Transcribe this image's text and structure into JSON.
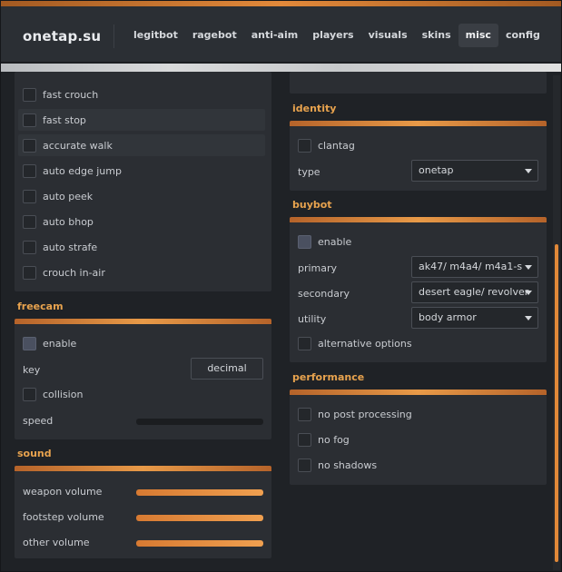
{
  "header": {
    "logo": "onetap.su",
    "tabs": [
      {
        "label": "legitbot"
      },
      {
        "label": "ragebot"
      },
      {
        "label": "anti-aim"
      },
      {
        "label": "players"
      },
      {
        "label": "visuals"
      },
      {
        "label": "skins"
      },
      {
        "label": "misc"
      },
      {
        "label": "config"
      }
    ],
    "active_tab": "misc"
  },
  "left": {
    "movement": {
      "items": [
        {
          "label": "fast crouch",
          "checked": false
        },
        {
          "label": "fast stop",
          "checked": false
        },
        {
          "label": "accurate walk",
          "checked": false
        },
        {
          "label": "auto edge jump",
          "checked": false
        },
        {
          "label": "auto peek",
          "checked": false
        },
        {
          "label": "auto bhop",
          "checked": false
        },
        {
          "label": "auto strafe",
          "checked": false
        },
        {
          "label": "crouch in-air",
          "checked": false
        }
      ]
    },
    "freecam": {
      "title": "freecam",
      "enable_label": "enable",
      "key_label": "key",
      "key_value": "decimal",
      "collision_label": "collision",
      "speed_label": "speed",
      "speed_value": 0
    },
    "sound": {
      "title": "sound",
      "sliders": [
        {
          "label": "weapon volume",
          "value": 100
        },
        {
          "label": "footstep volume",
          "value": 100
        },
        {
          "label": "other volume",
          "value": 100
        }
      ]
    }
  },
  "right": {
    "identity": {
      "title": "identity",
      "clantag_label": "clantag",
      "type_label": "type",
      "type_value": "onetap"
    },
    "buybot": {
      "title": "buybot",
      "enable_label": "enable",
      "primary_label": "primary",
      "primary_value": "ak47/ m4a4/ m4a1-s",
      "secondary_label": "secondary",
      "secondary_value": "desert eagle/ revolver",
      "utility_label": "utility",
      "utility_value": "body armor",
      "alt_label": "alternative options"
    },
    "performance": {
      "title": "performance",
      "items": [
        {
          "label": "no post processing"
        },
        {
          "label": "no fog"
        },
        {
          "label": "no shadows"
        }
      ]
    }
  },
  "colors": {
    "accent": "#e8a34e",
    "bar": "#e08838",
    "panel": "#2b2e33",
    "background": "#1f2226"
  }
}
